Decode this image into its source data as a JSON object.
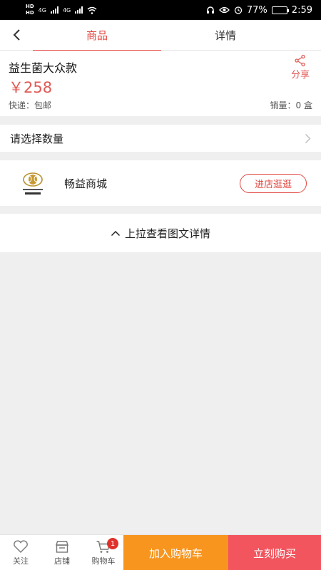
{
  "status_bar": {
    "network_left": "4G",
    "network_right": "4G",
    "battery_percent": "77%",
    "battery_level": 0.77,
    "time": "2:59"
  },
  "nav": {
    "tabs": [
      {
        "label": "商品",
        "active": true
      },
      {
        "label": "详情",
        "active": false
      }
    ]
  },
  "product": {
    "title": "益生菌大众款",
    "price": "￥258",
    "shipping": "快递：包邮",
    "sales": "销量：0 盒",
    "share_label": "分享"
  },
  "quantity": {
    "label": "请选择数量"
  },
  "shop": {
    "name": "畅益商城",
    "enter_label": "进店逛逛"
  },
  "detail_prompt": {
    "label": "上拉查看图文详情"
  },
  "bottom_bar": {
    "favorite_label": "关注",
    "store_label": "店铺",
    "cart_label": "购物车",
    "cart_count": "1",
    "add_to_cart_label": "加入购物车",
    "buy_now_label": "立刻购买"
  },
  "colors": {
    "accent": "#e0453f",
    "price": "#e05a54",
    "add_to_cart": "#f7951e",
    "buy_now": "#f2555e"
  }
}
